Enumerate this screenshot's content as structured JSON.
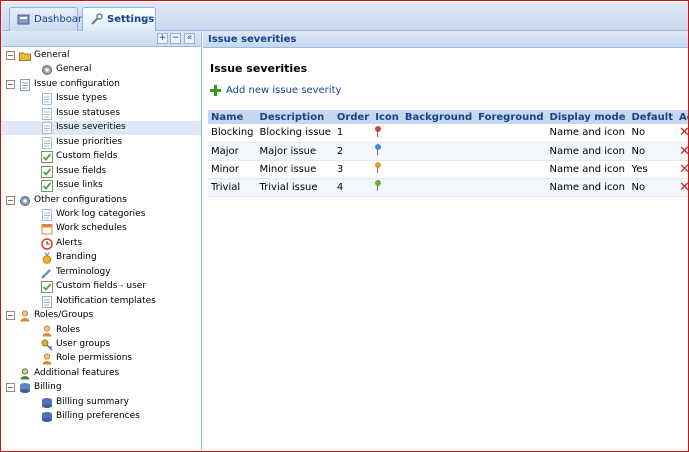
{
  "tabs": [
    {
      "label": "Dashboard",
      "icon": "dashboard-icon"
    },
    {
      "label": "Settings",
      "icon": "wrench-icon",
      "close": "×"
    }
  ],
  "tree_toolbar": {
    "expand": "+",
    "collapse": "−",
    "hide": "«"
  },
  "tree": [
    {
      "label": "General",
      "level": 0,
      "expander": "−",
      "icon": "folder-icon",
      "color": "#e9b83c"
    },
    {
      "label": "General",
      "level": 1,
      "icon": "gear-icon",
      "color": "#9aa7b5"
    },
    {
      "label": "Issue configuration",
      "level": 0,
      "expander": "−",
      "icon": "list-icon",
      "color": "#8f9db0"
    },
    {
      "label": "Issue types",
      "level": 1,
      "icon": "page-icon",
      "color": "#a7bbd4"
    },
    {
      "label": "Issue statuses",
      "level": 1,
      "icon": "page-icon",
      "color": "#a7bbd4"
    },
    {
      "label": "Issue severities",
      "level": 1,
      "icon": "page-icon",
      "color": "#a7bbd4",
      "selected": true
    },
    {
      "label": "Issue priorities",
      "level": 1,
      "icon": "page-icon",
      "color": "#a7bbd4"
    },
    {
      "label": "Custom fields",
      "level": 1,
      "icon": "checkbox-icon",
      "color": "#53a43a"
    },
    {
      "label": "Issue fields",
      "level": 1,
      "icon": "checkbox-icon",
      "color": "#53a43a"
    },
    {
      "label": "Issue links",
      "level": 1,
      "icon": "checkbox-icon",
      "color": "#53a43a"
    },
    {
      "label": "Other configurations",
      "level": 0,
      "expander": "−",
      "icon": "gears-icon",
      "color": "#8f9db0"
    },
    {
      "label": "Work log categories",
      "level": 1,
      "icon": "page-icon",
      "color": "#a7bbd4"
    },
    {
      "label": "Work schedules",
      "level": 1,
      "icon": "calendar-icon",
      "color": "#d98a3d"
    },
    {
      "label": "Alerts",
      "level": 1,
      "icon": "clock-icon",
      "color": "#d2412e"
    },
    {
      "label": "Branding",
      "level": 1,
      "icon": "medal-icon",
      "color": "#e6b323"
    },
    {
      "label": "Terminology",
      "level": 1,
      "icon": "pen-icon",
      "color": "#6e8fbf"
    },
    {
      "label": "Custom fields - user",
      "level": 1,
      "icon": "checkbox-icon",
      "color": "#53a43a"
    },
    {
      "label": "Notification templates",
      "level": 1,
      "icon": "page-gear-icon",
      "color": "#9fb2cc"
    },
    {
      "label": "Roles/Groups",
      "level": 0,
      "expander": "−",
      "icon": "users-icon",
      "color": "#d9862f"
    },
    {
      "label": "Roles",
      "level": 1,
      "icon": "user-icon",
      "color": "#d9862f"
    },
    {
      "label": "User groups",
      "level": 1,
      "icon": "key-icon",
      "color": "#4f7ec0"
    },
    {
      "label": "Role permissions",
      "level": 1,
      "icon": "user-lock-icon",
      "color": "#d9862f"
    },
    {
      "label": "Additional features",
      "level": 0,
      "icon": "user-plus-icon",
      "color": "#3f8a35"
    },
    {
      "label": "Billing",
      "level": 0,
      "expander": "−",
      "icon": "database-icon",
      "color": "#5b86c5"
    },
    {
      "label": "Billing summary",
      "level": 1,
      "icon": "database-icon",
      "color": "#4a74b7"
    },
    {
      "label": "Billing preferences",
      "level": 1,
      "icon": "database-gear-icon",
      "color": "#4a74b7"
    }
  ],
  "panel": {
    "header": "Issue severities",
    "title": "Issue severities",
    "add_label": "Add new issue severity"
  },
  "table": {
    "columns": [
      "Name",
      "Description",
      "Order",
      "Icon",
      "Background",
      "Foreground",
      "Display mode",
      "Default",
      "Actions"
    ],
    "rows": [
      {
        "name": "Blocking",
        "description": "Blocking issue",
        "order": "1",
        "icon_color": "#d1492a",
        "display_mode": "Name and icon",
        "default": "No"
      },
      {
        "name": "Major",
        "description": "Major issue",
        "order": "2",
        "icon_color": "#3a8fd6",
        "display_mode": "Name and icon",
        "default": "No"
      },
      {
        "name": "Minor",
        "description": "Minor issue",
        "order": "3",
        "icon_color": "#e0a51f",
        "display_mode": "Name and icon",
        "default": "Yes"
      },
      {
        "name": "Trivial",
        "description": "Trivial issue",
        "order": "4",
        "icon_color": "#5fb52e",
        "display_mode": "Name and icon",
        "default": "No"
      }
    ],
    "delete_glyph": "✕"
  }
}
